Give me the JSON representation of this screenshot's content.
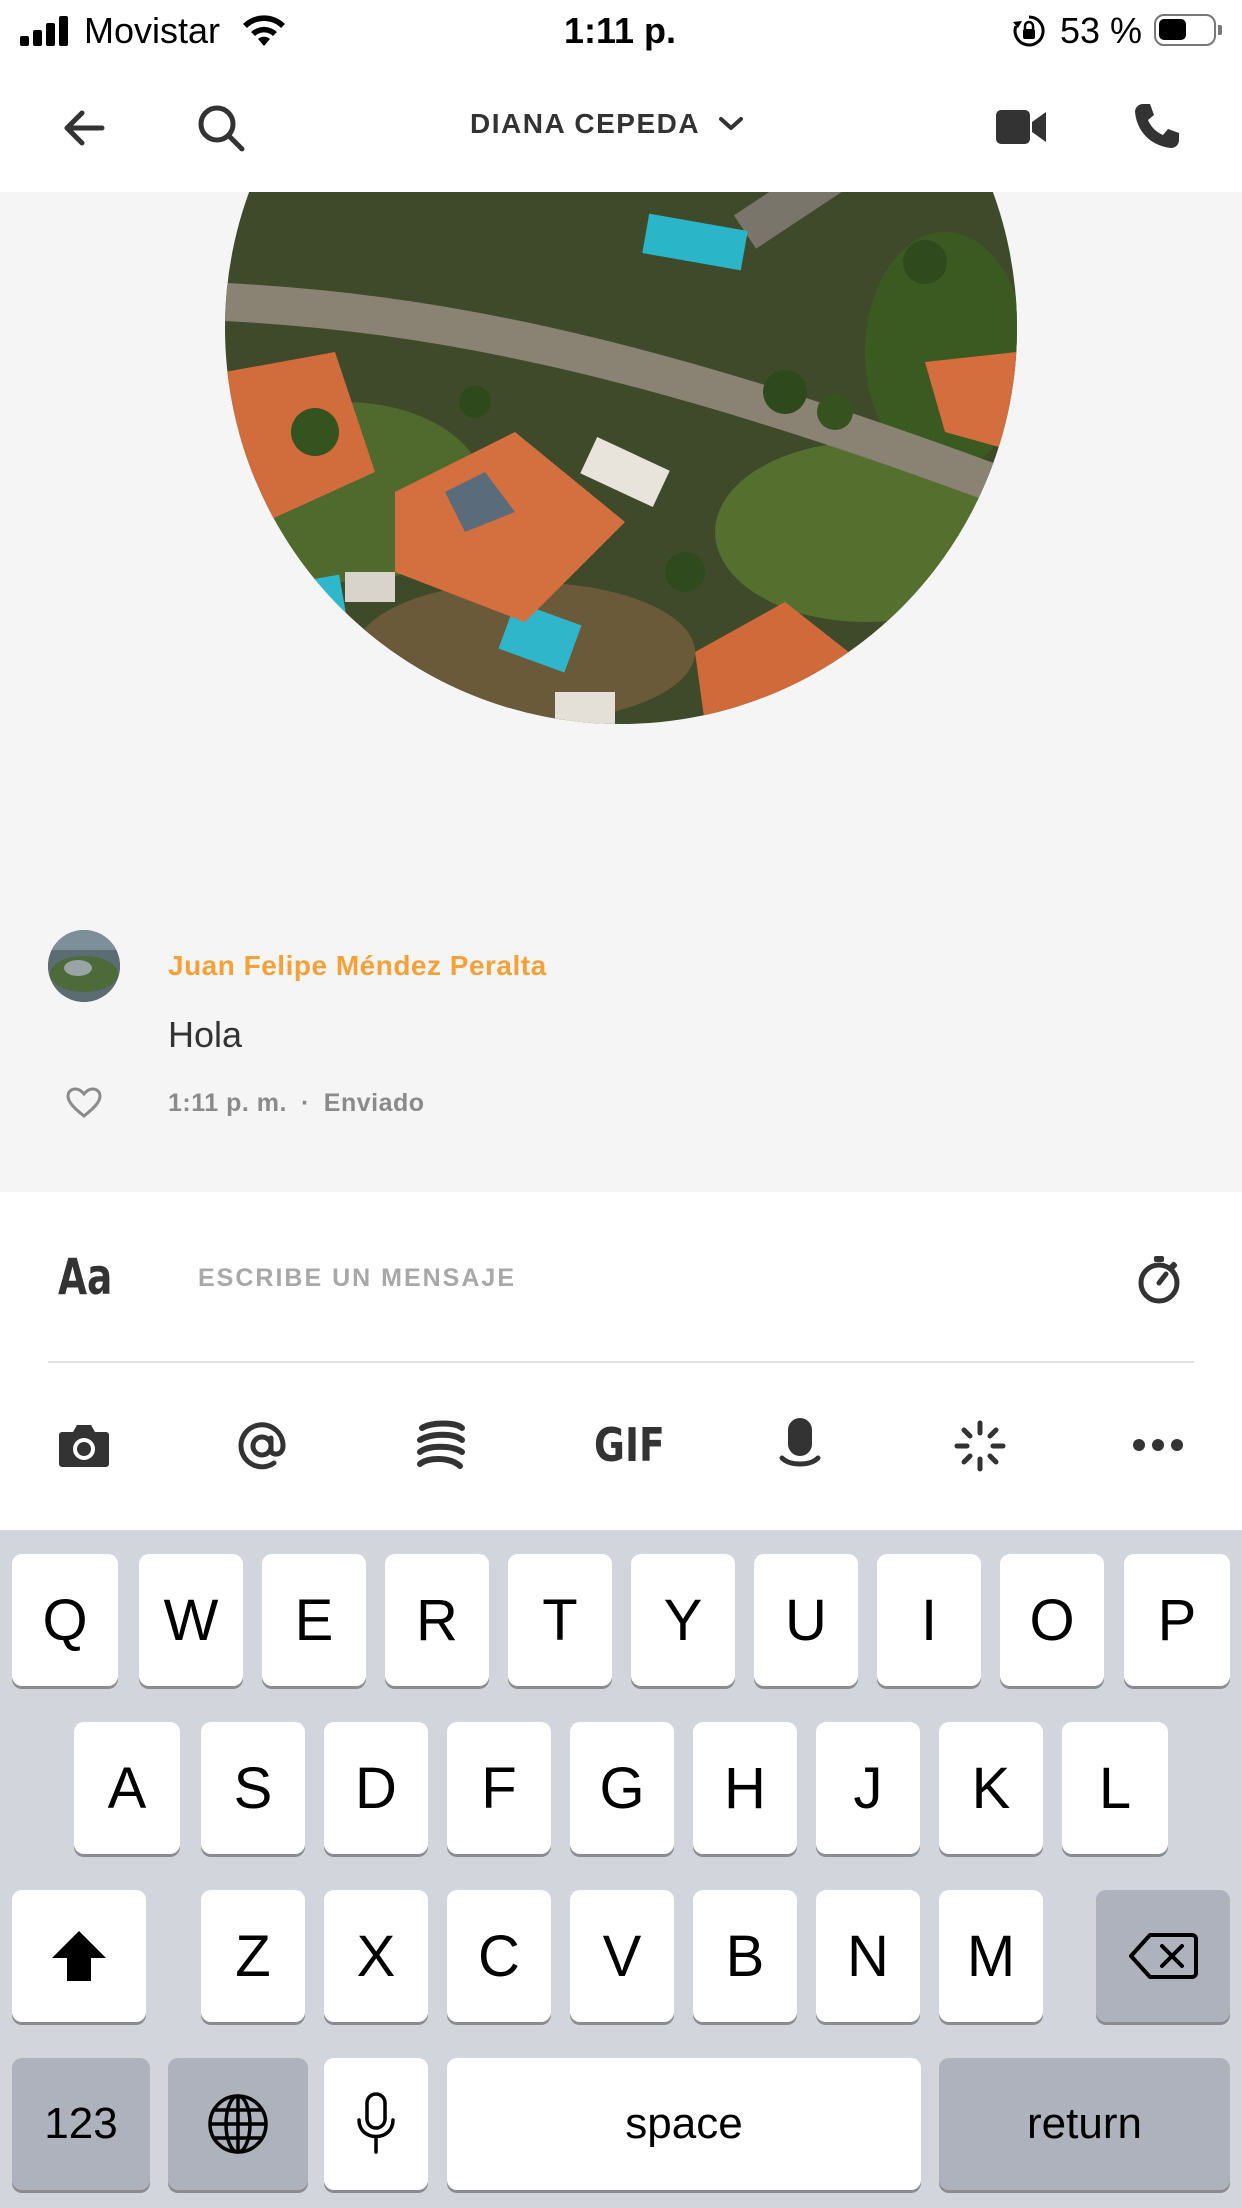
{
  "status_bar": {
    "carrier": "Movistar",
    "time": "1:11 p. m.",
    "battery_percent": "53 %",
    "battery_level": 0.53,
    "icons": [
      "signal-bars-icon",
      "wifi-icon",
      "rotation-lock-icon",
      "battery-icon"
    ]
  },
  "header": {
    "title": "DIANA CEPEDA",
    "icons": [
      "back-arrow-icon",
      "search-icon",
      "chevron-down-icon",
      "video-camera-icon",
      "phone-icon"
    ]
  },
  "conversation": {
    "messages": [
      {
        "sender": "Juan Felipe Méndez Peralta",
        "text": "Hola",
        "time": "1:11 p. m.",
        "separator": "·",
        "status": "Enviado"
      }
    ]
  },
  "composer": {
    "format_label": "Aa",
    "placeholder": "ESCRIBE UN MENSAJE",
    "toolbar_icons": [
      "camera-icon",
      "mention-icon",
      "giphy-stack-icon",
      "gif-icon",
      "microphone-icon",
      "sparkle-icon",
      "more-icon"
    ],
    "gif_label": "GIF"
  },
  "keyboard": {
    "row1": [
      "Q",
      "W",
      "E",
      "R",
      "T",
      "Y",
      "U",
      "I",
      "O",
      "P"
    ],
    "row2": [
      "A",
      "S",
      "D",
      "F",
      "G",
      "H",
      "J",
      "K",
      "L"
    ],
    "row3": [
      "Z",
      "X",
      "C",
      "V",
      "B",
      "N",
      "M"
    ],
    "numbers_key": "123",
    "space_key": "space",
    "return_key": "return"
  },
  "colors": {
    "accent_sender": "#f5a13a",
    "chat_background": "#f5f5f5",
    "keyboard_background": "#d2d5db"
  }
}
